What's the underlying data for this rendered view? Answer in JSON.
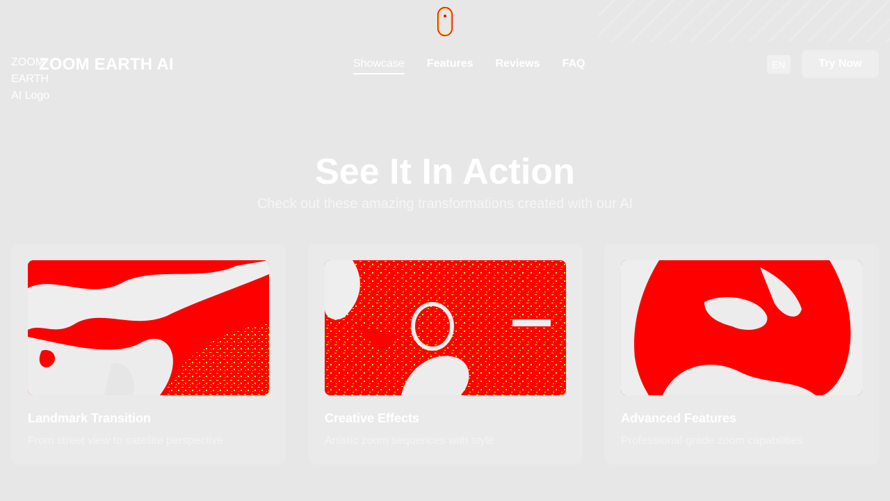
{
  "header": {
    "logo_alt": "ZOOM EARTH AI Logo",
    "logo_text": "ZOOM EARTH AI",
    "nav": [
      {
        "label": "Showcase",
        "active": true
      },
      {
        "label": "Features",
        "active": false
      },
      {
        "label": "Reviews",
        "active": false
      },
      {
        "label": "FAQ",
        "active": false
      }
    ],
    "language": "EN",
    "cta_label": "Try Now"
  },
  "hero": {
    "title": "See It In Action",
    "subtitle": "Check out these amazing transformations created with our AI"
  },
  "cards": [
    {
      "title": "Landmark Transition",
      "description": "From street view to satellite perspective"
    },
    {
      "title": "Creative Effects",
      "description": "Artistic zoom sequences with style"
    },
    {
      "title": "Advanced Features",
      "description": "Professional-grade zoom capabilities"
    }
  ],
  "colors": {
    "background": "#e7e7e7",
    "media": "#ff0000",
    "speckle": "#ffff00"
  },
  "icons": {
    "scroll_indicator": "mouse-scroll-icon"
  }
}
